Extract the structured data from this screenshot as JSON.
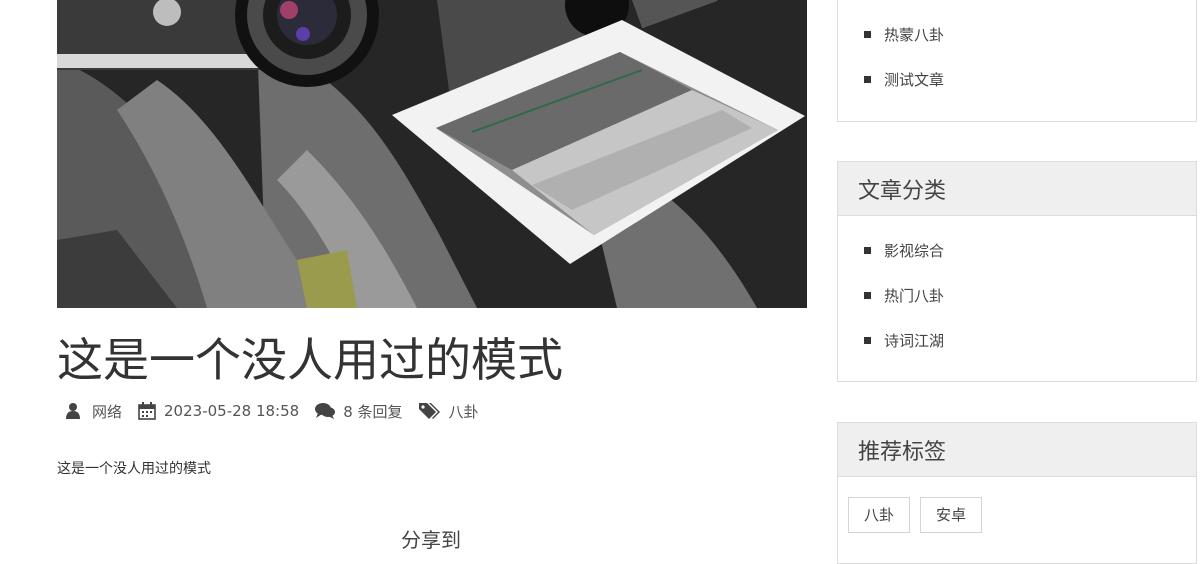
{
  "post": {
    "title": "这是一个没人用过的模式",
    "author": "网络",
    "date": "2023-05-28 18:58",
    "comments": "8 条回复",
    "category": "八卦",
    "content": "这是一个没人用过的模式",
    "share_label": "分享到"
  },
  "sidebar": {
    "recent": {
      "items": [
        "热蒙八卦",
        "测试文章"
      ]
    },
    "categories": {
      "title": "文章分类",
      "items": [
        "影视综合",
        "热门八卦",
        "诗词江湖"
      ]
    },
    "tags": {
      "title": "推荐标签",
      "items": [
        "八卦",
        "安卓"
      ]
    }
  }
}
